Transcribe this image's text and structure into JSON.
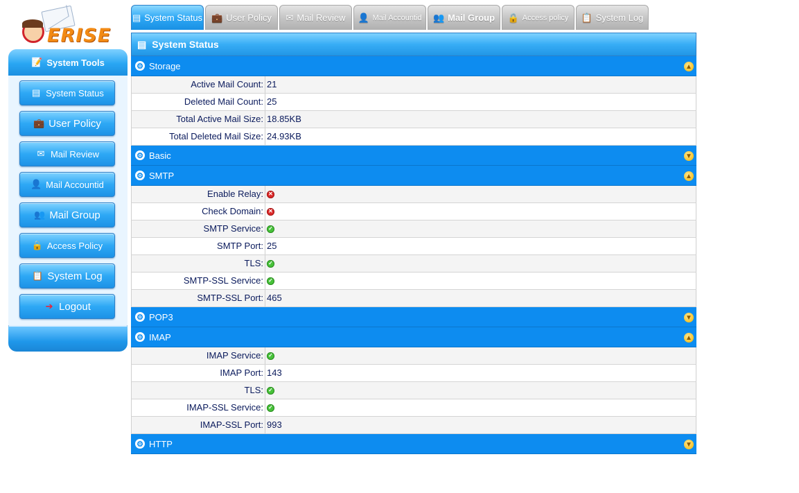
{
  "logo": {
    "text": "ERISE"
  },
  "sidebar": {
    "title": "System Tools",
    "items": [
      {
        "label": "System Status",
        "icon": "server-icon"
      },
      {
        "label": "User Policy",
        "icon": "briefcase-icon"
      },
      {
        "label": "Mail Review",
        "icon": "envelope-icon"
      },
      {
        "label": "Mail Accountid",
        "icon": "user-icon"
      },
      {
        "label": "Mail Group",
        "icon": "group-icon"
      },
      {
        "label": "Access Policy",
        "icon": "lock-icon"
      },
      {
        "label": "System Log",
        "icon": "log-icon"
      },
      {
        "label": "Logout",
        "icon": "logout-icon"
      }
    ]
  },
  "tabs": [
    {
      "label": "System Status",
      "active": true
    },
    {
      "label": "User Policy"
    },
    {
      "label": "Mail Review"
    },
    {
      "label": "Mail Accountid"
    },
    {
      "label": "Mail Group"
    },
    {
      "label": "Access policy"
    },
    {
      "label": "System Log"
    }
  ],
  "panel": {
    "title": "System Status"
  },
  "sections": {
    "storage": {
      "title": "Storage",
      "rows": [
        {
          "label": "Active Mail Count:",
          "value": "21"
        },
        {
          "label": "Deleted Mail Count:",
          "value": "25"
        },
        {
          "label": "Total Active Mail Size:",
          "value": "18.85KB"
        },
        {
          "label": "Total Deleted Mail Size:",
          "value": "24.93KB"
        }
      ]
    },
    "basic": {
      "title": "Basic"
    },
    "smtp": {
      "title": "SMTP",
      "rows": [
        {
          "label": "Enable Relay:",
          "status": "off"
        },
        {
          "label": "Check Domain:",
          "status": "off"
        },
        {
          "label": "SMTP Service:",
          "status": "on"
        },
        {
          "label": "SMTP Port:",
          "value": "25"
        },
        {
          "label": "TLS:",
          "status": "on"
        },
        {
          "label": "SMTP-SSL Service:",
          "status": "on"
        },
        {
          "label": "SMTP-SSL Port:",
          "value": "465"
        }
      ]
    },
    "pop3": {
      "title": "POP3"
    },
    "imap": {
      "title": "IMAP",
      "rows": [
        {
          "label": "IMAP Service:",
          "status": "on"
        },
        {
          "label": "IMAP Port:",
          "value": "143"
        },
        {
          "label": "TLS:",
          "status": "on"
        },
        {
          "label": "IMAP-SSL Service:",
          "status": "on"
        },
        {
          "label": "IMAP-SSL Port:",
          "value": "993"
        }
      ]
    },
    "http": {
      "title": "HTTP"
    }
  },
  "colors": {
    "section_bar": "#0d8cf0",
    "label_text": "#0a1a5c",
    "status_on": "#48c23a",
    "status_off": "#dd2a2a"
  }
}
